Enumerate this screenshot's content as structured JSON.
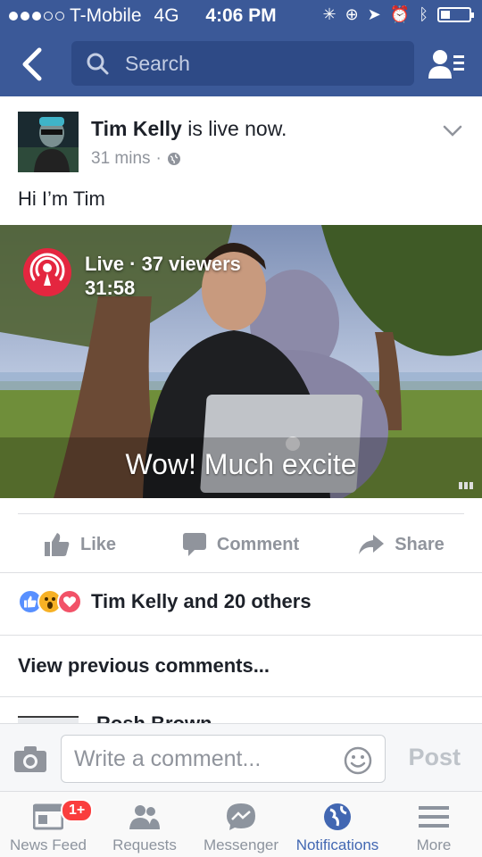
{
  "status_bar": {
    "carrier": "T-Mobile",
    "network": "4G",
    "time": "4:06 PM"
  },
  "nav": {
    "search_placeholder": "Search"
  },
  "post": {
    "author": "Tim Kelly",
    "status_suffix": "is live now.",
    "time_ago": "31 mins",
    "meta_separator": "·",
    "body": "Hi I’m Tim",
    "video": {
      "live_line": "Live · 37 viewers",
      "duration": "31:58",
      "caption": "Wow! Much excite"
    }
  },
  "actions": {
    "like": "Like",
    "comment": "Comment",
    "share": "Share"
  },
  "reactions": {
    "summary": "Tim Kelly and 20 others",
    "types": [
      "like",
      "wow",
      "love"
    ],
    "colors": {
      "like": "#5890ff",
      "wow": "#f7b125",
      "love": "#f25268"
    }
  },
  "comments": {
    "view_previous": "View previous comments...",
    "partial_author": "Rosh Brown"
  },
  "composer": {
    "placeholder": "Write a comment...",
    "post_label": "Post"
  },
  "tabs": [
    {
      "label": "News Feed",
      "icon": "news-feed-icon",
      "badge": "1+"
    },
    {
      "label": "Requests",
      "icon": "requests-icon"
    },
    {
      "label": "Messenger",
      "icon": "messenger-icon"
    },
    {
      "label": "Notifications",
      "icon": "globe-icon",
      "active": true
    },
    {
      "label": "More",
      "icon": "menu-icon"
    }
  ],
  "colors": {
    "brand": "#3b5998",
    "live_red": "#e4263f",
    "badge_red": "#fa3e3e",
    "active_tab": "#4267b2"
  }
}
